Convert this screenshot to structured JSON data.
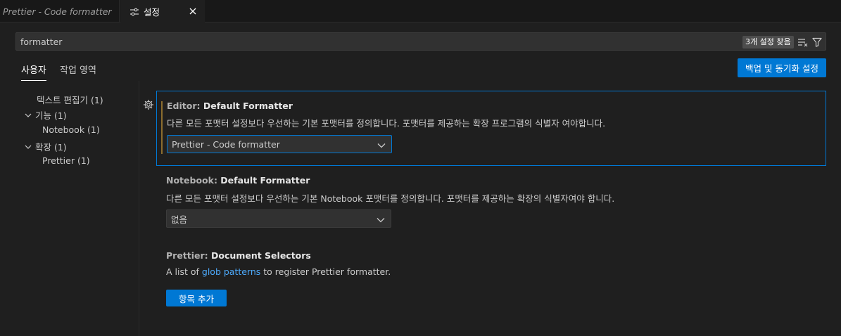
{
  "tabs": {
    "inactive_label": "Prettier - Code formatter",
    "active_label": "설정"
  },
  "search": {
    "value": "formatter",
    "result_count": "3개 설정 찾음"
  },
  "scope": {
    "user_label": "사용자",
    "workspace_label": "작업 영역",
    "sync_button_label": "백업 및 동기화 설정"
  },
  "toc": {
    "items": [
      {
        "label": "텍스트 편집기 (1)"
      },
      {
        "label": "기능 (1)"
      },
      {
        "label": "Notebook (1)"
      },
      {
        "label": "확장 (1)"
      },
      {
        "label": "Prettier (1)"
      }
    ]
  },
  "settings": {
    "editor_formatter": {
      "category": "Editor:",
      "name": "Default Formatter",
      "description": "다른 모든 포맷터 설정보다 우선하는 기본 포맷터를 정의합니다. 포맷터를 제공하는 확장 프로그램의 식별자 여야합니다.",
      "value": "Prettier - Code formatter"
    },
    "notebook_formatter": {
      "category": "Notebook:",
      "name": "Default Formatter",
      "description": "다른 모든 포맷터 설정보다 우선하는 기본 Notebook 포맷터를 정의합니다. 포맷터를 제공하는 확장의 식별자여야 합니다.",
      "value": "없음"
    },
    "prettier_selectors": {
      "category": "Prettier:",
      "name": "Document Selectors",
      "desc_prefix": "A list of ",
      "desc_link": "glob patterns",
      "desc_suffix": " to register Prettier formatter.",
      "add_button_label": "항목 추가"
    }
  },
  "colors": {
    "accent": "#0078d4",
    "link": "#4daafc",
    "modified_bar": "#8c6d2e",
    "background": "#1f1f1f"
  }
}
